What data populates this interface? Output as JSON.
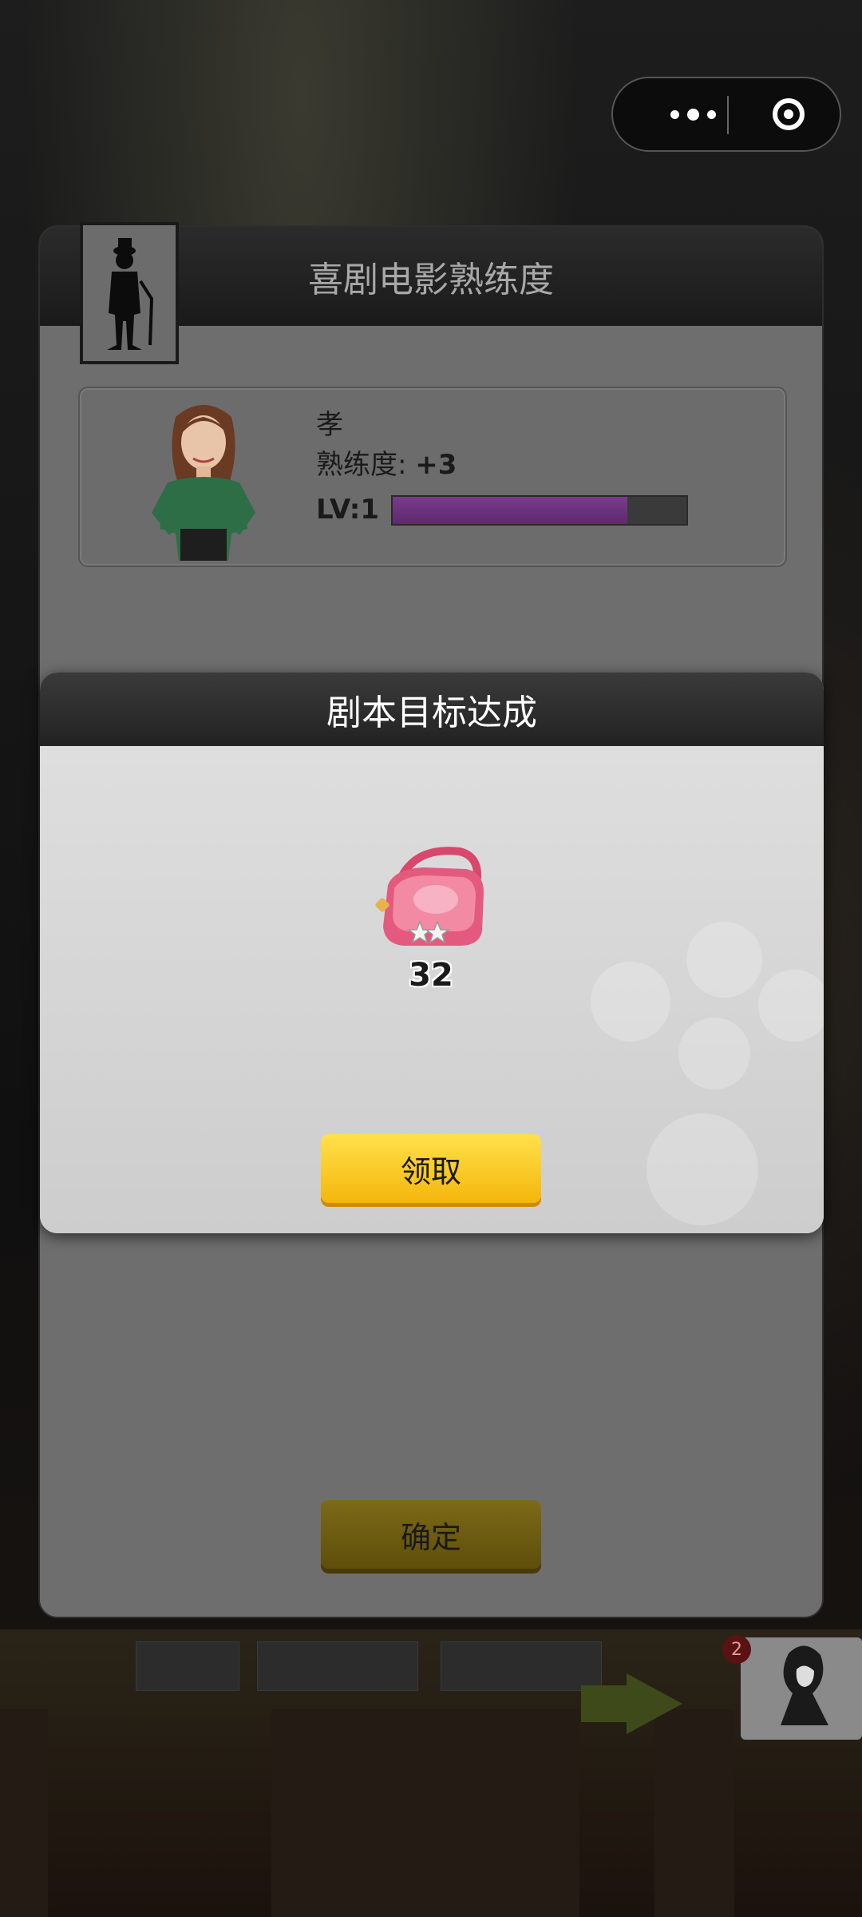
{
  "miniprogram_capsule": {
    "more_icon": "more-dots-icon",
    "close_icon": "target-close-icon"
  },
  "proficiency_dialog": {
    "title": "喜剧电影熟练度",
    "actor": {
      "name": "孝",
      "proficiency_label": "熟练度:",
      "proficiency_value": "+3",
      "level_label": "LV:1",
      "level_progress": 0.8,
      "bar_color": "#6e3280"
    },
    "confirm_label": "确定"
  },
  "reward_popup": {
    "title": "剧本目标达成",
    "reward_item": {
      "icon": "pink-bag-icon",
      "count": "32"
    },
    "claim_label": "领取"
  },
  "background": {
    "side_badge_count": "2"
  },
  "colors": {
    "claim_button": "#f8c81e",
    "confirm_button_dimmed": "#6e5e12"
  }
}
